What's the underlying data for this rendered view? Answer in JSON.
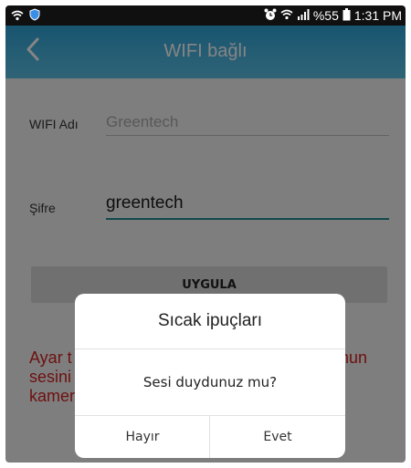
{
  "status_bar": {
    "battery_percent": "%55",
    "time": "1:31 PM"
  },
  "app_bar": {
    "title": "WIFI bağlı"
  },
  "form": {
    "wifi_label": "WIFI Adı",
    "wifi_value": "Greentech",
    "password_label": "Şifre",
    "password_value": "greentech",
    "apply_label": "UYGULA"
  },
  "notice": {
    "line1_left": "Ayar t",
    "line1_right": "nun",
    "line2": "sesini",
    "line3": "kamer"
  },
  "dialog": {
    "title": "Sıcak ipuçları",
    "message": "Sesi duydunuz mu?",
    "no_label": "Hayır",
    "yes_label": "Evet"
  },
  "colors": {
    "app_bar": "#2fa3d6",
    "notice_text": "#d42222",
    "active_underline": "#1f8c8f"
  }
}
